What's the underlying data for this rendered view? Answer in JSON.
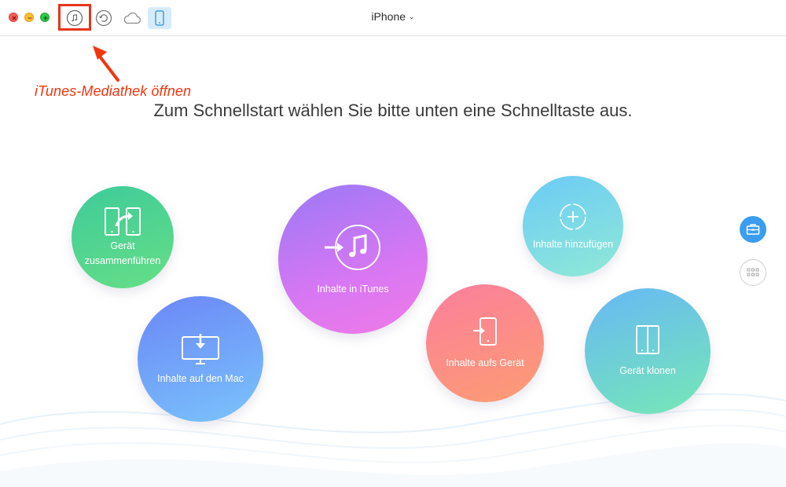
{
  "toolbar": {
    "device_name": "iPhone",
    "device_dropdown_glyph": "⌄",
    "buttons": [
      {
        "name": "itunes-library-button",
        "icon": "music-note-icon"
      },
      {
        "name": "backup-button",
        "icon": "restore-icon"
      },
      {
        "name": "icloud-button",
        "icon": "cloud-icon"
      },
      {
        "name": "device-button",
        "icon": "phone-icon"
      }
    ]
  },
  "annotation": {
    "text": "iTunes-Mediathek öffnen",
    "color": "#f0360f"
  },
  "main": {
    "headline": "Zum Schnellstart wählen Sie bitte unten eine Schnelltaste aus."
  },
  "shortcuts": [
    {
      "id": "merge",
      "label": "Gerät zusammenführen",
      "icon": "merge-devices-icon"
    },
    {
      "id": "mac",
      "label": "Inhalte auf den Mac",
      "icon": "monitor-download-icon"
    },
    {
      "id": "itunes",
      "label": "Inhalte in iTunes",
      "icon": "itunes-transfer-icon"
    },
    {
      "id": "device",
      "label": "Inhalte aufs Gerät",
      "icon": "phone-import-icon"
    },
    {
      "id": "add",
      "label": "Inhalte hinzufügen",
      "icon": "add-circle-icon"
    },
    {
      "id": "clone",
      "label": "Gerät klonen",
      "icon": "clone-device-icon"
    }
  ],
  "sidebar": {
    "items": [
      {
        "name": "toolbox-button",
        "icon": "toolbox-icon"
      },
      {
        "name": "apps-grid-button",
        "icon": "grid-icon"
      }
    ]
  },
  "colors": {
    "accent_blue": "#3a9df0",
    "annotation_red": "#e8341c"
  }
}
